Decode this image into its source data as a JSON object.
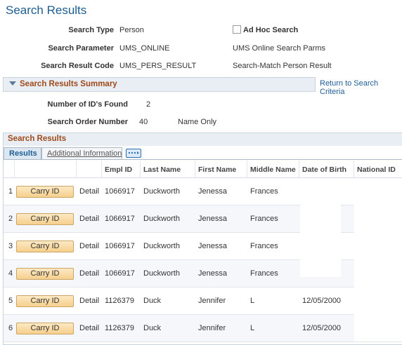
{
  "page": {
    "title": "Search Results"
  },
  "criteria": {
    "search_type_label": "Search Type",
    "search_type_value": "Person",
    "ad_hoc_label": "Ad Hoc Search",
    "search_param_label": "Search Parameter",
    "search_param_value": "UMS_ONLINE",
    "search_param_desc": "UMS Online Search Parms",
    "result_code_label": "Search Result Code",
    "result_code_value": "UMS_PERS_RESULT",
    "result_code_desc": "Search-Match Person Result"
  },
  "summary": {
    "header": "Search Results Summary",
    "return_link": "Return to Search Criteria",
    "ids_found_label": "Number of ID's Found",
    "ids_found_value": "2",
    "order_label": "Search Order Number",
    "order_value": "40",
    "order_desc": "Name Only"
  },
  "grid": {
    "title": "Search Results",
    "tabs": [
      "Results",
      "Additional Information"
    ],
    "columns": [
      "Empl ID",
      "Last Name",
      "First Name",
      "Middle Name",
      "Date of Birth",
      "National ID"
    ],
    "carry_label": "Carry ID",
    "detail_label": "Detail",
    "rows": [
      {
        "num": "1",
        "empl_id": "1066917",
        "last": "Duckworth",
        "first": "Jenessa",
        "middle": "Frances",
        "dob": "",
        "natl": ""
      },
      {
        "num": "2",
        "empl_id": "1066917",
        "last": "Duckworth",
        "first": "Jenessa",
        "middle": "Frances",
        "dob": "",
        "natl": ""
      },
      {
        "num": "3",
        "empl_id": "1066917",
        "last": "Duckworth",
        "first": "Jenessa",
        "middle": "Frances",
        "dob": "",
        "natl": ""
      },
      {
        "num": "4",
        "empl_id": "1066917",
        "last": "Duckworth",
        "first": "Jenessa",
        "middle": "Frances",
        "dob": "",
        "natl": ""
      },
      {
        "num": "5",
        "empl_id": "1126379",
        "last": "Duck",
        "first": "Jennifer",
        "middle": "L",
        "dob": "12/05/2000",
        "natl": ""
      },
      {
        "num": "6",
        "empl_id": "1126379",
        "last": "Duck",
        "first": "Jennifer",
        "middle": "L",
        "dob": "12/05/2000",
        "natl": ""
      }
    ]
  }
}
